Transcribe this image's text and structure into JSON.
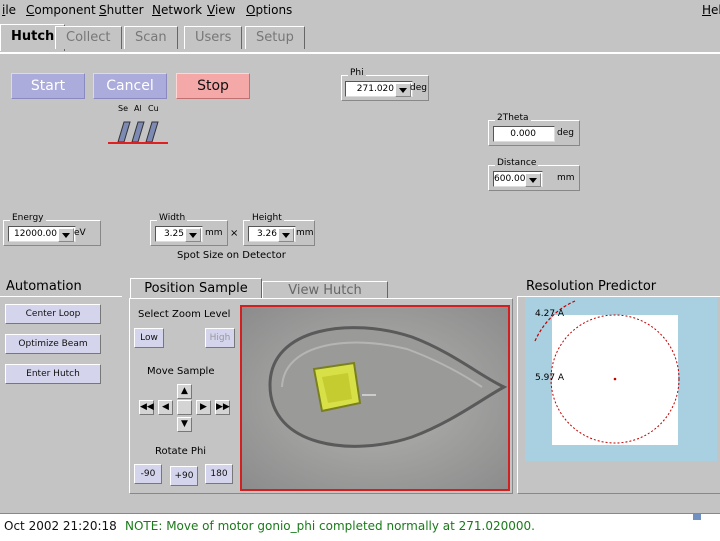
{
  "menubar": {
    "items": [
      "ile",
      "Component",
      "Shutter",
      "Network",
      "View",
      "Options"
    ],
    "help": "Hel"
  },
  "tabs": [
    "Hutch",
    "Collect",
    "Scan",
    "Users",
    "Setup"
  ],
  "controls": {
    "start": "Start",
    "cancel": "Cancel",
    "stop": "Stop"
  },
  "filters": [
    "Se",
    "Al",
    "Cu"
  ],
  "phi": {
    "label": "Phi",
    "value": "271.020",
    "unit": "deg"
  },
  "twotheta": {
    "label": "2Theta",
    "value": "0.000",
    "unit": "deg"
  },
  "distance": {
    "label": "Distance",
    "value": "600.000",
    "unit": "mm"
  },
  "energy": {
    "label": "Energy",
    "value": "12000.00",
    "unit": "eV"
  },
  "width": {
    "label": "Width",
    "value": "3.25",
    "unit": "mm"
  },
  "height": {
    "label": "Height",
    "value": "3.26",
    "unit": "mm"
  },
  "times_sign": "×",
  "spot_size_label": "Spot Size on Detector",
  "automation": {
    "title": "Automation",
    "buttons": [
      "Center Loop",
      "Optimize Beam",
      "Enter Hutch"
    ]
  },
  "sample_tabs": [
    "Position Sample",
    "View Hutch"
  ],
  "position": {
    "zoom_label": "Select Zoom Level",
    "low": "Low",
    "high": "High",
    "move_label": "Move Sample",
    "rotate_label": "Rotate Phi",
    "rotate_buttons": [
      "-90",
      "+90",
      "180"
    ]
  },
  "resolution": {
    "title": "Resolution Predictor",
    "outer": "4.27 A",
    "inner": "5.97 A"
  },
  "status": {
    "timestamp": "Oct 2002 21:20:18",
    "message": "NOTE: Move of motor gonio_phi completed normally at 271.020000."
  },
  "colors": {
    "background": "#c4c4c4",
    "button_blue": "#ababdc",
    "stop_red": "#f4a8a8",
    "status_green": "#1a7a1a",
    "resolution_bg": "#a8d0e0"
  }
}
